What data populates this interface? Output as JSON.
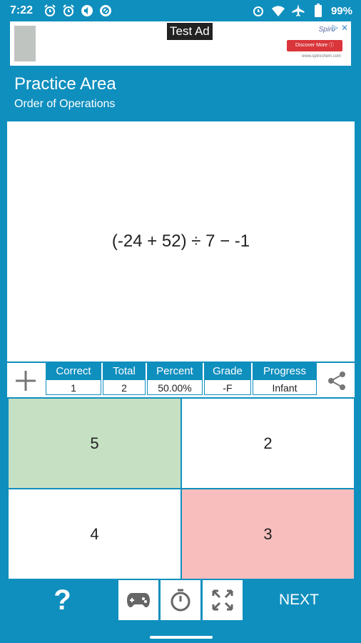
{
  "status_bar": {
    "time": "7:22",
    "battery": "99%",
    "left_icons": [
      "alarm-icon",
      "alarm-icon",
      "volume-icon",
      "do-not-disturb-icon"
    ],
    "right_icons": [
      "alarm-icon",
      "wifi-icon",
      "airplane-icon",
      "battery-icon"
    ]
  },
  "ad": {
    "label": "Test Ad",
    "brand": "Spiro",
    "cta": "Discover More ⓘ",
    "url": "www.spirochem.com"
  },
  "header": {
    "title": "Practice Area",
    "subtitle": "Order of Operations"
  },
  "problem": {
    "expression": "(-24 + 52) ÷ 7 − -1"
  },
  "stats": {
    "headers": [
      "Correct",
      "Total",
      "Percent",
      "Grade",
      "Progress"
    ],
    "values": [
      "1",
      "2",
      "50.00%",
      "-F",
      "Infant"
    ]
  },
  "answers": [
    {
      "value": "5",
      "state": "correct"
    },
    {
      "value": "2",
      "state": "plain"
    },
    {
      "value": "4",
      "state": "plain"
    },
    {
      "value": "3",
      "state": "wrong"
    }
  ],
  "toolbar": {
    "help_label": "?",
    "next_label": "NEXT",
    "icons": [
      "gamepad-icon",
      "timer-icon",
      "fullscreen-icon"
    ]
  },
  "colors": {
    "accent": "#0f8fbe",
    "correct": "#c6e0c4",
    "wrong": "#f8bebe"
  }
}
